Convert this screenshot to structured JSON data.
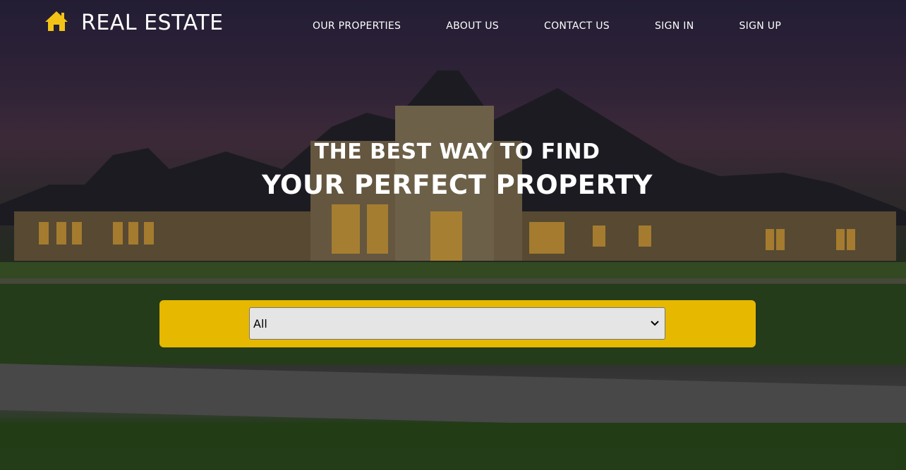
{
  "brand": {
    "name": "REAL ESTATE",
    "icon": "home-icon",
    "icon_color": "#f2c316"
  },
  "nav": {
    "items": [
      {
        "label": "OUR PROPERTIES"
      },
      {
        "label": "ABOUT US"
      },
      {
        "label": "CONTACT US"
      },
      {
        "label": "SIGN IN"
      },
      {
        "label": "SIGN UP"
      }
    ]
  },
  "hero": {
    "line1": "THE BEST WAY TO FIND",
    "line2": "YOUR PERFECT PROPERTY"
  },
  "search": {
    "selected": "All",
    "bar_color": "#e6b800"
  }
}
